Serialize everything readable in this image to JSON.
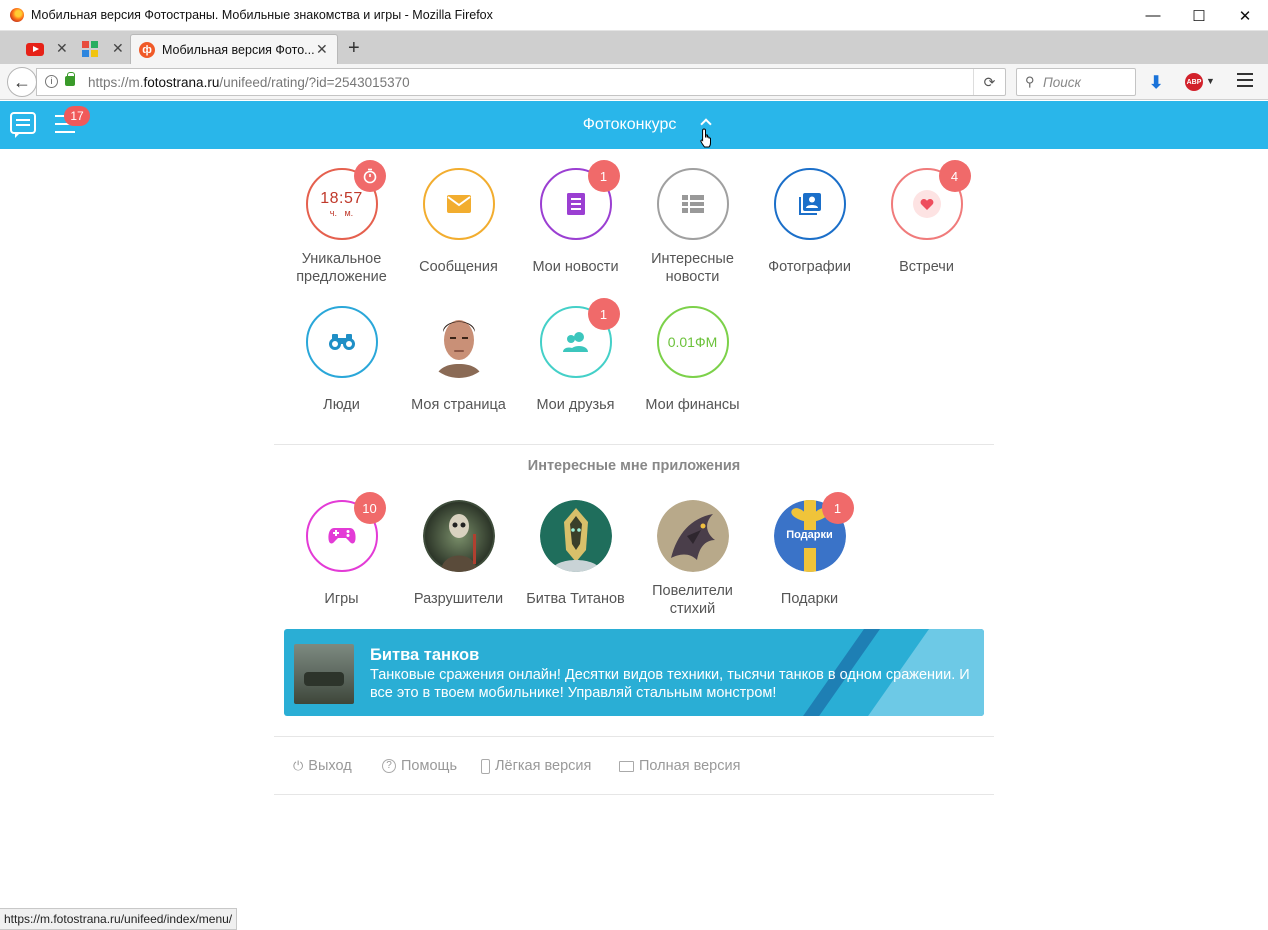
{
  "window": {
    "title": "Мобильная версия Фотостраны. Мобильные знакомства и игры - Mozilla Firefox",
    "minimize": "—",
    "maximize": "☐",
    "close": "✕"
  },
  "tabs": {
    "active_title": "Мобильная версия Фото...",
    "close": "✕",
    "new_tab": "+"
  },
  "navbar": {
    "url_prefix": "https://m.",
    "url_domain": "fotostrana.ru",
    "url_path": "/unifeed/rating/?id=2543015370",
    "search_placeholder": "Поиск"
  },
  "header": {
    "title": "Фотоконкурс",
    "menu_badge": "17"
  },
  "menu_items": [
    {
      "label": "Уникальное предложение",
      "clock_time": "18:57",
      "clock_units": "ч.   м."
    },
    {
      "label": "Сообщения"
    },
    {
      "label": "Мои новости",
      "badge": "1"
    },
    {
      "label": "Интересные новости"
    },
    {
      "label": "Фотографии"
    },
    {
      "label": "Встречи",
      "badge": "4"
    },
    {
      "label": "Люди"
    },
    {
      "label": "Моя страница"
    },
    {
      "label": "Мои друзья",
      "badge": "1"
    },
    {
      "label": "Мои финансы",
      "finance_value": "0.01ФМ"
    }
  ],
  "apps": {
    "section_title": "Интересные мне приложения",
    "items": [
      {
        "label": "Игры",
        "badge": "10"
      },
      {
        "label": "Разрушители"
      },
      {
        "label": "Битва Титанов"
      },
      {
        "label": "Повелители стихий"
      },
      {
        "label": "Подарки",
        "badge": "1",
        "tile_text": "Подарки"
      }
    ]
  },
  "banner": {
    "title": "Битва танков",
    "text": "Танковые сражения онлайн! Десятки видов техники, тысячи танков в одном сражении. И все это в твоем мобильнике! Управляй стальным монстром!"
  },
  "footer": {
    "logout": "Выход",
    "help": "Помощь",
    "light_version": "Лёгкая версия",
    "full_version": "Полная версия"
  },
  "statusbar": {
    "url": "https://m.fotostrana.ru/unifeed/index/menu/"
  },
  "colors": {
    "header_bg": "#29b6ea",
    "badge": "#f06a6a",
    "offer": "#e5604e",
    "messages": "#f2ad2f",
    "news": "#9b3fd2",
    "interesting": "#a0a0a0",
    "photos": "#1b6fc9",
    "meetings": "#f07b7b",
    "people": "#2aa7d9",
    "friends": "#44d0c8",
    "finance": "#7cd14a",
    "games": "#e33bd6"
  }
}
